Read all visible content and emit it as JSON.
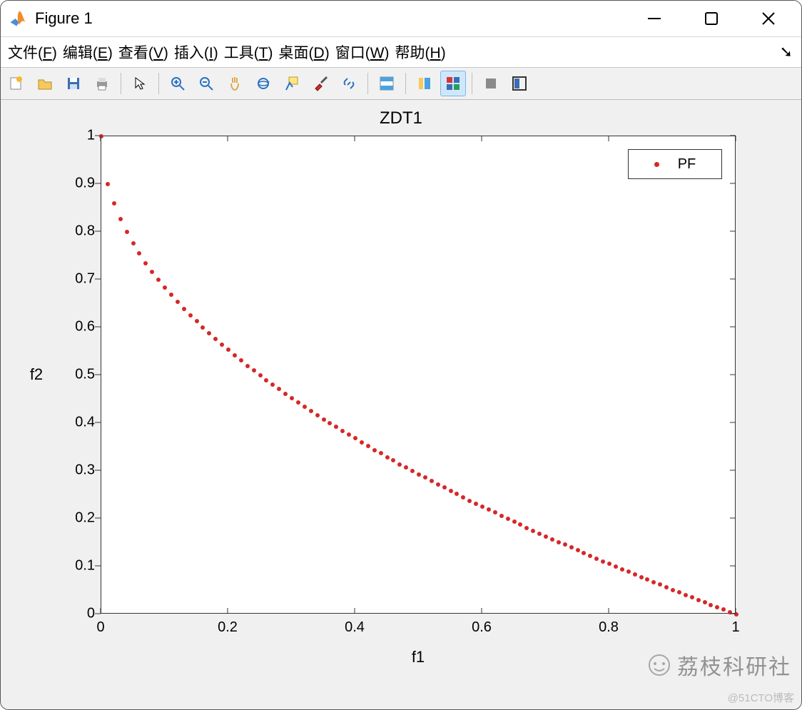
{
  "window": {
    "title": "Figure 1"
  },
  "menu": {
    "items": [
      {
        "label": "文件",
        "accel": "F"
      },
      {
        "label": "编辑",
        "accel": "E"
      },
      {
        "label": "查看",
        "accel": "V"
      },
      {
        "label": "插入",
        "accel": "I"
      },
      {
        "label": "工具",
        "accel": "T"
      },
      {
        "label": "桌面",
        "accel": "D"
      },
      {
        "label": "窗口",
        "accel": "W"
      },
      {
        "label": "帮助",
        "accel": "H"
      }
    ]
  },
  "toolbar": {
    "buttons": [
      "new-figure-icon",
      "open-icon",
      "save-icon",
      "print-icon",
      "|",
      "pointer-icon",
      "|",
      "zoom-in-icon",
      "zoom-out-icon",
      "pan-icon",
      "rotate3d-icon",
      "data-cursor-icon",
      "brush-icon",
      "link-icon",
      "|",
      "colorbar-icon",
      "|",
      "insert-legend-icon",
      "plot-tools-icon",
      "|",
      "hide-tools-icon",
      "dock-icon"
    ],
    "active": "plot-tools-icon"
  },
  "legend": {
    "label": "PF"
  },
  "watermarks": {
    "brand": "荔枝科研社",
    "blog": "@51CTO博客"
  },
  "chart_data": {
    "type": "scatter",
    "title": "ZDT1",
    "xlabel": "f1",
    "ylabel": "f2",
    "xlim": [
      0,
      1
    ],
    "ylim": [
      0,
      1
    ],
    "xticks": [
      0,
      0.2,
      0.4,
      0.6,
      0.8,
      1
    ],
    "yticks": [
      0,
      0.1,
      0.2,
      0.3,
      0.4,
      0.5,
      0.6,
      0.7,
      0.8,
      0.9,
      1
    ],
    "series": [
      {
        "name": "PF",
        "x": [
          0.0,
          0.01,
          0.02,
          0.03,
          0.04,
          0.05,
          0.06,
          0.07,
          0.08,
          0.09,
          0.1,
          0.11,
          0.12,
          0.13,
          0.14,
          0.15,
          0.16,
          0.17,
          0.18,
          0.19,
          0.2,
          0.21,
          0.22,
          0.23,
          0.24,
          0.25,
          0.26,
          0.27,
          0.28,
          0.29,
          0.3,
          0.31,
          0.32,
          0.33,
          0.34,
          0.35,
          0.36,
          0.37,
          0.38,
          0.39,
          0.4,
          0.41,
          0.42,
          0.43,
          0.44,
          0.45,
          0.46,
          0.47,
          0.48,
          0.49,
          0.5,
          0.51,
          0.52,
          0.53,
          0.54,
          0.55,
          0.56,
          0.57,
          0.58,
          0.59,
          0.6,
          0.61,
          0.62,
          0.63,
          0.64,
          0.65,
          0.66,
          0.67,
          0.68,
          0.69,
          0.7,
          0.71,
          0.72,
          0.73,
          0.74,
          0.75,
          0.76,
          0.77,
          0.78,
          0.79,
          0.8,
          0.81,
          0.82,
          0.83,
          0.84,
          0.85,
          0.86,
          0.87,
          0.88,
          0.89,
          0.9,
          0.91,
          0.92,
          0.93,
          0.94,
          0.95,
          0.96,
          0.97,
          0.98,
          0.99,
          1.0
        ],
        "y": [
          1.0,
          0.9,
          0.859,
          0.827,
          0.8,
          0.776,
          0.755,
          0.735,
          0.717,
          0.7,
          0.684,
          0.668,
          0.654,
          0.639,
          0.626,
          0.613,
          0.6,
          0.588,
          0.576,
          0.564,
          0.553,
          0.542,
          0.531,
          0.52,
          0.51,
          0.5,
          0.49,
          0.48,
          0.471,
          0.461,
          0.452,
          0.443,
          0.434,
          0.426,
          0.417,
          0.408,
          0.4,
          0.392,
          0.384,
          0.376,
          0.368,
          0.36,
          0.352,
          0.344,
          0.337,
          0.329,
          0.322,
          0.314,
          0.307,
          0.3,
          0.293,
          0.286,
          0.279,
          0.272,
          0.265,
          0.258,
          0.252,
          0.245,
          0.238,
          0.232,
          0.225,
          0.219,
          0.213,
          0.206,
          0.2,
          0.194,
          0.188,
          0.181,
          0.175,
          0.169,
          0.163,
          0.157,
          0.151,
          0.146,
          0.14,
          0.134,
          0.128,
          0.123,
          0.117,
          0.111,
          0.106,
          0.1,
          0.094,
          0.089,
          0.083,
          0.078,
          0.073,
          0.067,
          0.062,
          0.057,
          0.051,
          0.046,
          0.041,
          0.036,
          0.03,
          0.025,
          0.02,
          0.015,
          0.01,
          0.005,
          0.0
        ]
      }
    ]
  }
}
